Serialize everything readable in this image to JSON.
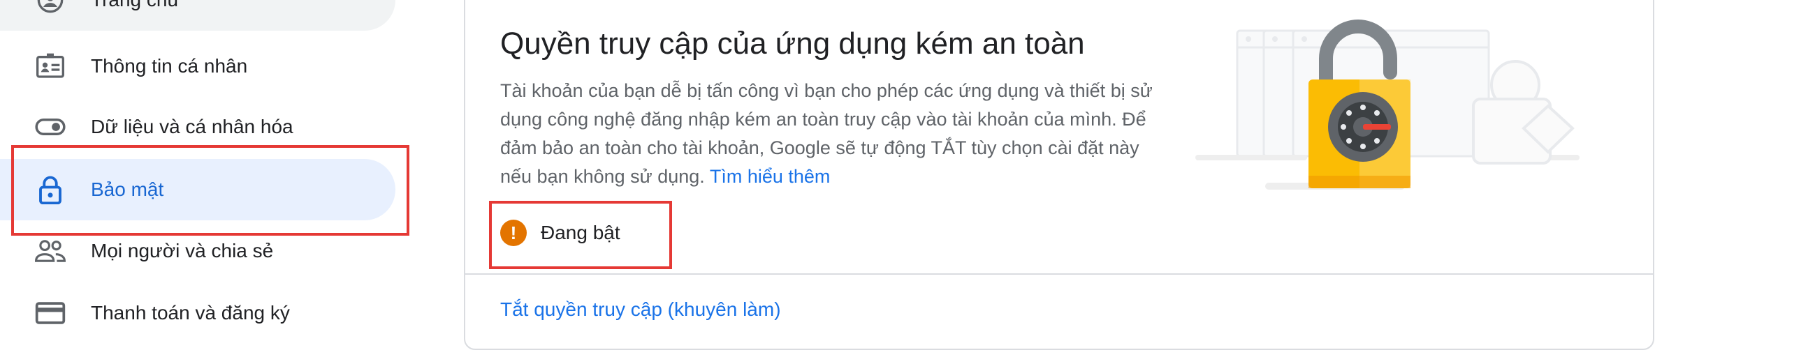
{
  "sidebar": {
    "items": [
      {
        "label": "Trang chủ",
        "icon": "home-user-icon"
      },
      {
        "label": "Thông tin cá nhân",
        "icon": "id-card-icon"
      },
      {
        "label": "Dữ liệu và cá nhân hóa",
        "icon": "toggle-icon"
      },
      {
        "label": "Bảo mật",
        "icon": "lock-icon",
        "active": true
      },
      {
        "label": "Mọi người và chia sẻ",
        "icon": "people-icon"
      },
      {
        "label": "Thanh toán và đăng ký",
        "icon": "credit-card-icon"
      }
    ]
  },
  "card": {
    "title": "Quyền truy cập của ứng dụng kém an toàn",
    "description": "Tài khoản của bạn dễ bị tấn công vì bạn cho phép các ứng dụng và thiết bị sử dụng công nghệ đăng nhập kém an toàn truy cập vào tài khoản của mình. Để đảm bảo an toàn cho tài khoản, Google sẽ tự động TẮT tùy chọn cài đặt này nếu bạn không sử dụng.",
    "learn_more": "Tìm hiểu thêm",
    "status_icon": "!",
    "status": "Đang bật",
    "action": "Tắt quyền truy cập (khuyên làm)"
  },
  "colors": {
    "accent": "#1a73e8",
    "active_bg": "#e8f0fe",
    "warning": "#e37400",
    "highlight": "#e53935",
    "lock": "#f9ab00"
  }
}
